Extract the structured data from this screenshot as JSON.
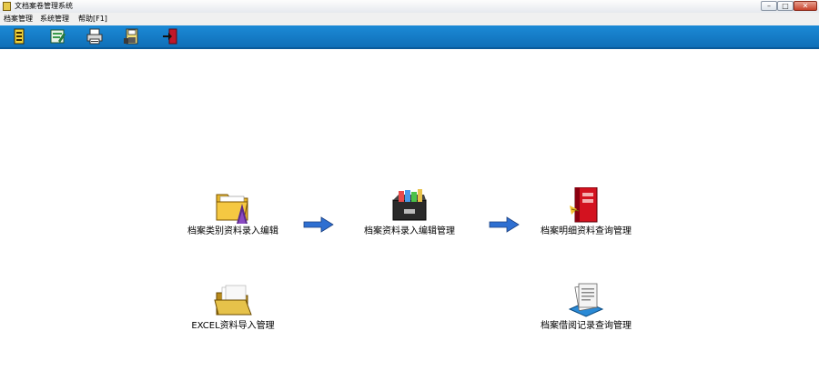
{
  "window": {
    "title": "文档案卷管理系统",
    "minimize_label": "–",
    "maximize_label": "□",
    "close_label": "✕"
  },
  "menu": {
    "items": [
      {
        "label": "档案管理"
      },
      {
        "label": "系统管理"
      },
      {
        "label": "帮助[F1]"
      }
    ]
  },
  "toolbar": {
    "buttons": [
      {
        "icon": "document-book-icon"
      },
      {
        "icon": "edit-form-icon"
      },
      {
        "icon": "printer-icon"
      },
      {
        "icon": "save-disk-icon"
      },
      {
        "icon": "exit-door-icon"
      }
    ]
  },
  "modules": [
    {
      "label": "档案类别资料录入编辑",
      "icon": "folder-icon"
    },
    {
      "label": "档案资料录入编辑管理",
      "icon": "file-box-icon"
    },
    {
      "label": "档案明细资料查询管理",
      "icon": "red-book-icon"
    },
    {
      "label": "EXCEL资料导入管理",
      "icon": "open-folder-icon"
    },
    {
      "label": "档案借阅记录查询管理",
      "icon": "documents-icon"
    }
  ],
  "colors": {
    "toolbar": "#1c8ad6",
    "arrow": "#2e6fd1"
  }
}
